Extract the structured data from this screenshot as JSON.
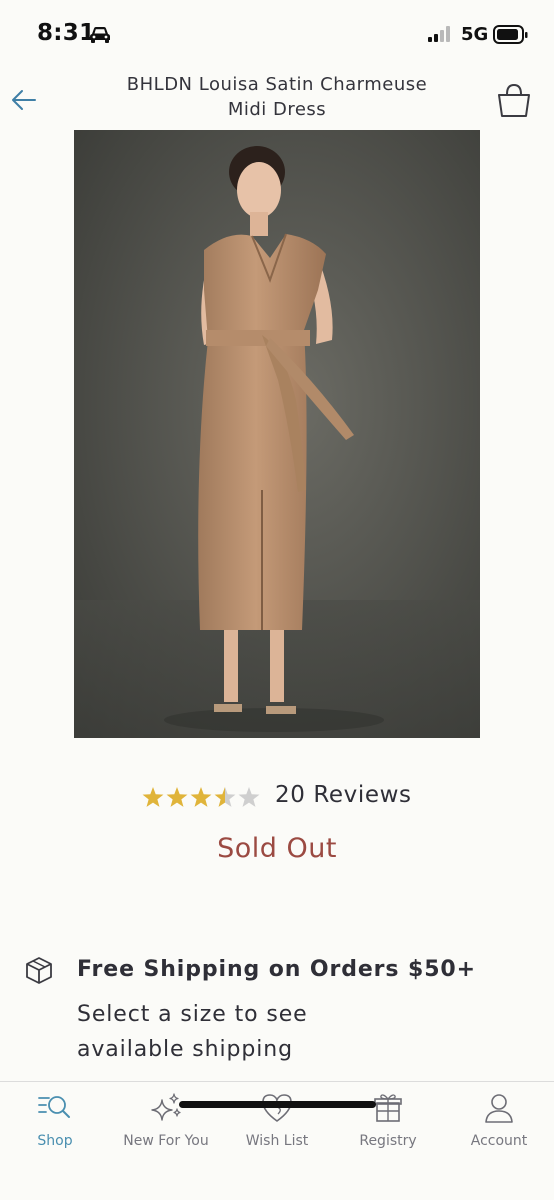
{
  "status_bar": {
    "time": "8:31",
    "network": "5G"
  },
  "header": {
    "title_line1": "BHLDN Louisa Satin Charmeuse",
    "title_line2": "Midi Dress"
  },
  "product": {
    "rating": 3.5,
    "rating_max": 5,
    "reviews_label": "20 Reviews",
    "availability": "Sold Out",
    "colors": {
      "star_filled": "#e0b43a",
      "star_empty": "#cfcfcf",
      "sold_out": "#9b4a42",
      "accent": "#4a8fb0"
    }
  },
  "shipping": {
    "title": "Free Shipping on Orders $50+",
    "note": "Select a size to see available shipping"
  },
  "tab_bar": {
    "tabs": [
      {
        "label": "Shop",
        "icon": "shop-search-icon",
        "active": true
      },
      {
        "label": "New For You",
        "icon": "sparkles-icon",
        "active": false
      },
      {
        "label": "Wish List",
        "icon": "heart-icon",
        "active": false
      },
      {
        "label": "Registry",
        "icon": "gift-icon",
        "active": false
      },
      {
        "label": "Account",
        "icon": "person-icon",
        "active": false
      }
    ]
  }
}
